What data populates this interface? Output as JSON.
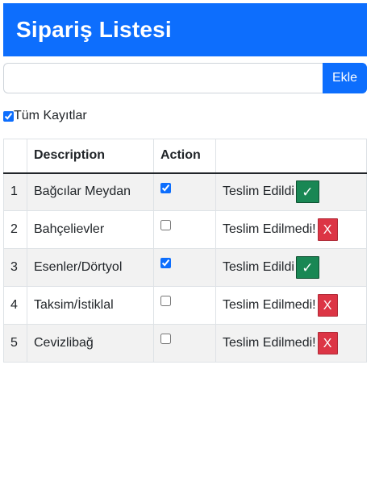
{
  "header": {
    "title": "Sipariş Listesi"
  },
  "add_form": {
    "input_value": "",
    "input_placeholder": "",
    "button_label": "Ekle"
  },
  "filter": {
    "label": "Tüm Kayıtlar",
    "checked": true
  },
  "table": {
    "columns": [
      "",
      "Description",
      "Action",
      ""
    ],
    "rows": [
      {
        "num": "1",
        "description": "Bağcılar Meydan",
        "checked": true,
        "status": "Teslim Edildi",
        "action_icon": "✓",
        "action_type": "done"
      },
      {
        "num": "2",
        "description": "Bahçelievler",
        "checked": false,
        "status": "Teslim Edilmedi!",
        "action_icon": "X",
        "action_type": "undone"
      },
      {
        "num": "3",
        "description": "Esenler/Dörtyol",
        "checked": true,
        "status": "Teslim Edildi",
        "action_icon": "✓",
        "action_type": "done"
      },
      {
        "num": "4",
        "description": "Taksim/İstiklal",
        "checked": false,
        "status": "Teslim Edilmedi!",
        "action_icon": "X",
        "action_type": "undone"
      },
      {
        "num": "5",
        "description": "Cevizlibağ",
        "checked": false,
        "status": "Teslim Edilmedi!",
        "action_icon": "X",
        "action_type": "undone"
      }
    ]
  },
  "colors": {
    "primary": "#0d6efd",
    "success": "#198754",
    "danger": "#dc3545",
    "stripe": "#f2f2f2"
  }
}
